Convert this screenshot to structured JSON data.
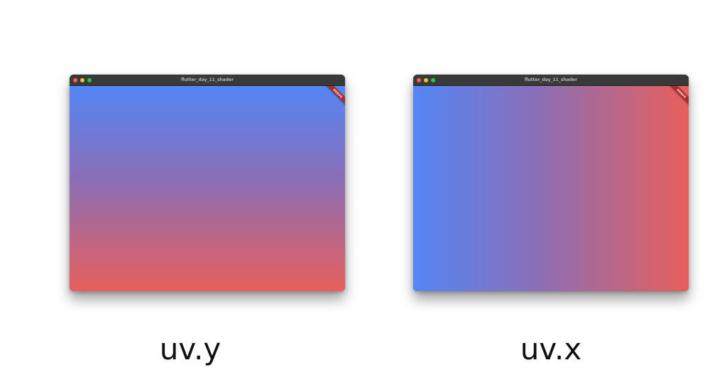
{
  "windows": [
    {
      "title": "flutter_day_11_shader",
      "debug_banner": "DEBUG",
      "gradient": {
        "direction": "vertical",
        "from": "#5486f6",
        "to": "#e85f5b"
      }
    },
    {
      "title": "flutter_day_11_shader",
      "debug_banner": "DEBUG",
      "gradient": {
        "direction": "horizontal",
        "from": "#5486f6",
        "to": "#e85f5b"
      }
    }
  ],
  "captions": {
    "left": "uv.y",
    "right": "uv.x"
  },
  "colors": {
    "traffic_close": "#ff5f57",
    "traffic_minimize": "#febc2e",
    "traffic_maximize": "#28c840",
    "titlebar": "#393939",
    "debug_banner": "#b02a2a"
  }
}
